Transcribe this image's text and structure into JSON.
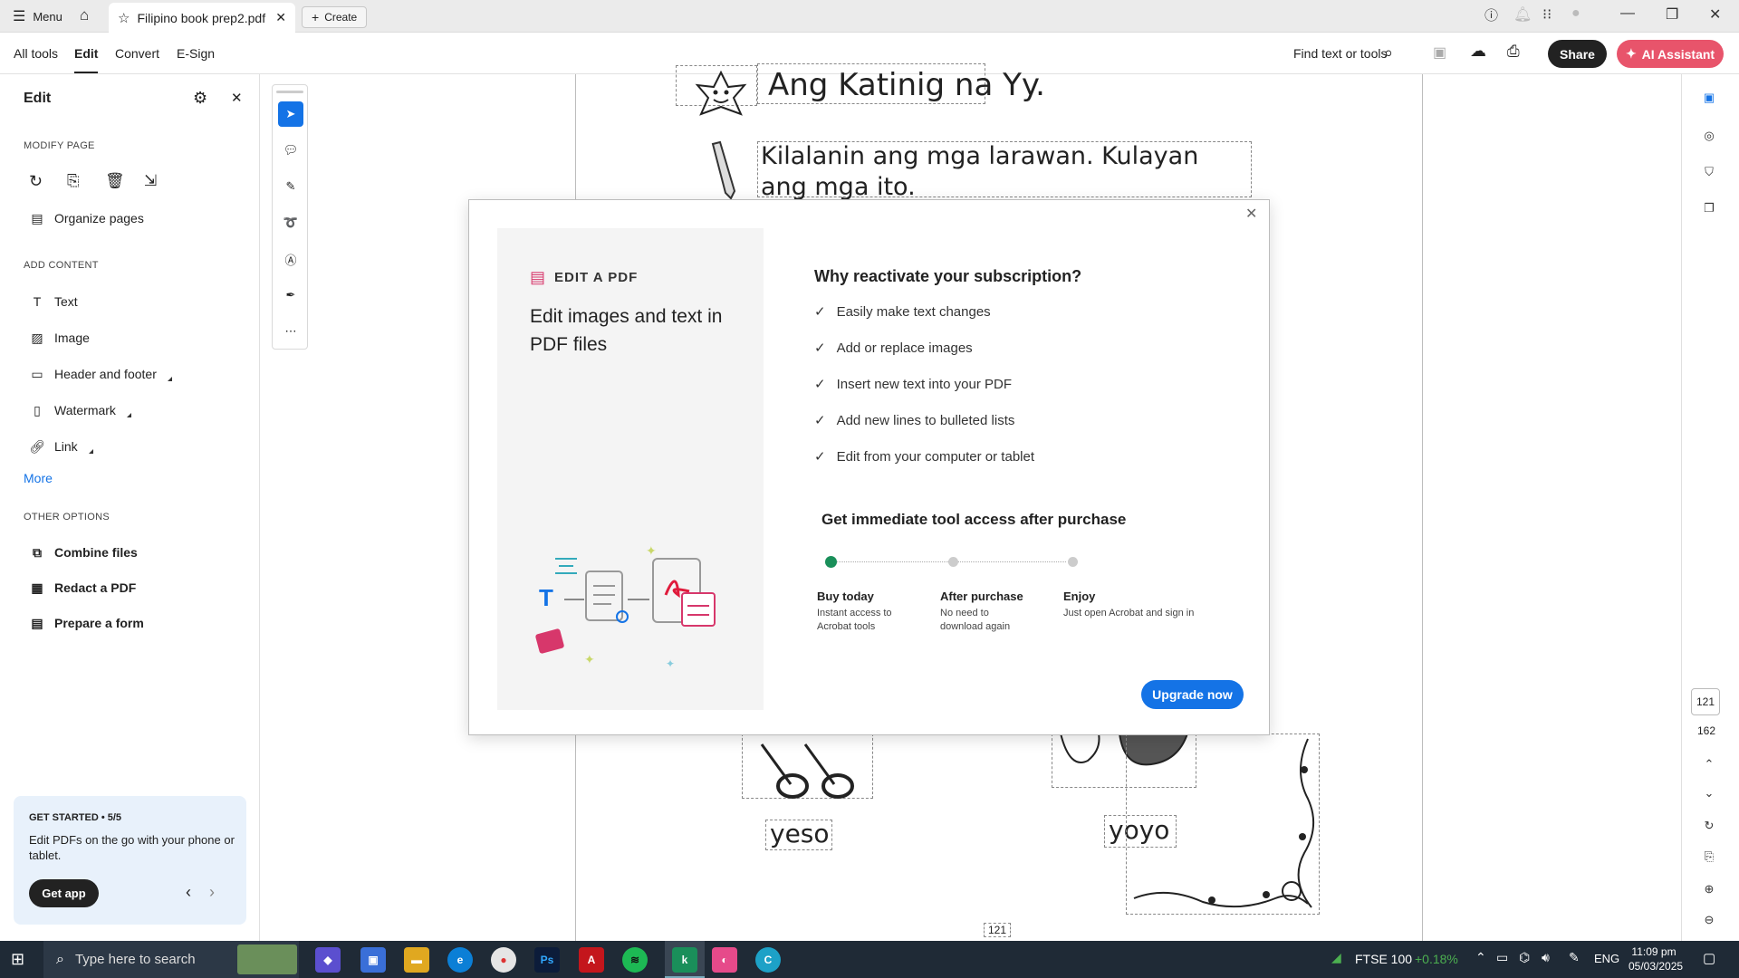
{
  "titlebar": {
    "menu_label": "Menu",
    "tab_title": "Filipino book prep2.pdf",
    "create_label": "Create"
  },
  "toolbar": {
    "nav": [
      "All tools",
      "Edit",
      "Convert",
      "E-Sign"
    ],
    "find_label": "Find text or tools",
    "share_label": "Share",
    "ai_label": "AI Assistant"
  },
  "leftpanel": {
    "title": "Edit",
    "modify_heading": "MODIFY PAGE",
    "organize_label": "Organize pages",
    "add_heading": "ADD CONTENT",
    "add_items": [
      "Text",
      "Image",
      "Header and footer",
      "Watermark",
      "Link"
    ],
    "more_label": "More",
    "other_heading": "OTHER OPTIONS",
    "other_items": [
      "Combine files",
      "Redact a PDF",
      "Prepare a form"
    ],
    "getstarted": {
      "title": "GET STARTED • 5/5",
      "body": "Edit PDFs on the go with your phone or tablet.",
      "button": "Get app"
    }
  },
  "document": {
    "heading": "Ang Katinig na Yy.",
    "instruction": "Kilalanin ang mga larawan. Kulayan ang mga ito.",
    "word1": "yeso",
    "word2": "yoyo",
    "page_label": "121"
  },
  "dialog": {
    "card_eyebrow": "EDIT A PDF",
    "card_title": "Edit images and text in PDF files",
    "heading": "Why reactivate your subscription?",
    "benefits": [
      "Easily make text changes",
      "Add or replace images",
      "Insert new text into your PDF",
      "Add new lines to bulleted lists",
      "Edit from your computer or tablet"
    ],
    "subheading": "Get immediate tool access after purchase",
    "steps": [
      {
        "title": "Buy today",
        "desc": "Instant access to Acrobat tools"
      },
      {
        "title": "After purchase",
        "desc": "No need to download again"
      },
      {
        "title": "Enjoy",
        "desc": "Just open Acrobat and sign in"
      }
    ],
    "upgrade_label": "Upgrade now"
  },
  "rightrail": {
    "current_page": "121",
    "total_pages": "162"
  },
  "taskbar": {
    "search_placeholder": "Type here to search",
    "ticker_name": "FTSE 100",
    "ticker_change": "+0.18%",
    "lang": "ENG",
    "time": "11:09 pm",
    "date": "05/03/2025"
  },
  "colors": {
    "accent_blue": "#1473e6",
    "ai_pink": "#e8546b",
    "step_green": "#1a8f5a",
    "taskbar_bg": "#1f2a36"
  }
}
